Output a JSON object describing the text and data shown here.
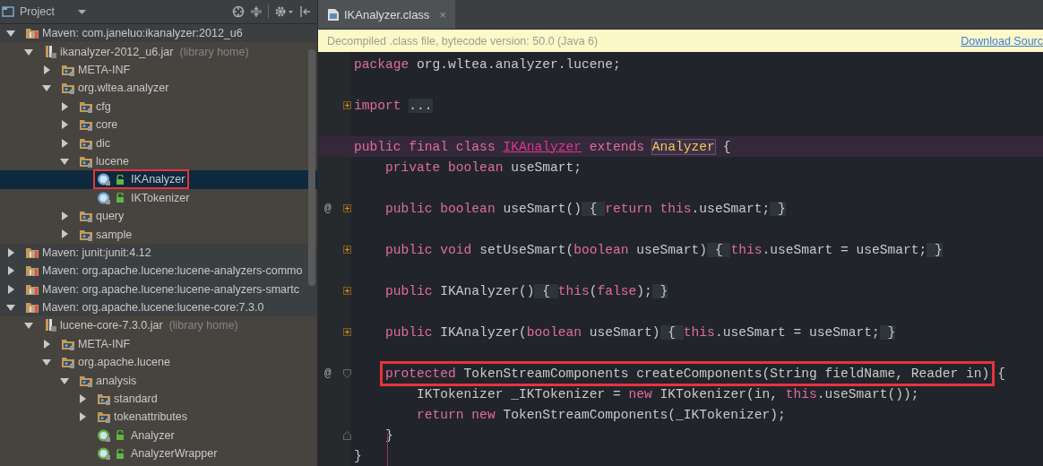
{
  "project_panel": {
    "title": "Project",
    "tree": [
      {
        "label": "Maven: com.janeluo:ikanalyzer:2012_u6",
        "kind": "maven",
        "expanded": true,
        "selected": false,
        "children": [
          {
            "label": "ikanalyzer-2012_u6.jar",
            "suffix": "(library home)",
            "kind": "jar",
            "expanded": true,
            "selected": false,
            "children": [
              {
                "label": "META-INF",
                "kind": "folder",
                "expanded": false,
                "selected": false
              },
              {
                "label": "org.wltea.analyzer",
                "kind": "folder",
                "expanded": true,
                "selected": false,
                "children": [
                  {
                    "label": "cfg",
                    "kind": "folder",
                    "expanded": false,
                    "selected": false
                  },
                  {
                    "label": "core",
                    "kind": "folder",
                    "expanded": false,
                    "selected": false
                  },
                  {
                    "label": "dic",
                    "kind": "folder",
                    "expanded": false,
                    "selected": false
                  },
                  {
                    "label": "lucene",
                    "kind": "folder",
                    "expanded": true,
                    "selected": false,
                    "children": [
                      {
                        "label": "IKAnalyzer",
                        "kind": "class",
                        "selected": true,
                        "annotated": true
                      },
                      {
                        "label": "IKTokenizer",
                        "kind": "class",
                        "selected": false
                      }
                    ]
                  },
                  {
                    "label": "query",
                    "kind": "folder",
                    "expanded": false,
                    "selected": false
                  },
                  {
                    "label": "sample",
                    "kind": "folder",
                    "expanded": false,
                    "selected": false
                  }
                ]
              }
            ]
          }
        ]
      },
      {
        "label": "Maven: junit:junit:4.12",
        "kind": "maven",
        "expanded": false,
        "selected": false
      },
      {
        "label": "Maven: org.apache.lucene:lucene-analyzers-commo",
        "kind": "maven",
        "expanded": false,
        "selected": false
      },
      {
        "label": "Maven: org.apache.lucene:lucene-analyzers-smartc",
        "kind": "maven",
        "expanded": false,
        "selected": false
      },
      {
        "label": "Maven: org.apache.lucene:lucene-core:7.3.0",
        "kind": "maven",
        "expanded": true,
        "selected": false,
        "children": [
          {
            "label": "lucene-core-7.3.0.jar",
            "suffix": "(library home)",
            "kind": "jar",
            "expanded": true,
            "selected": false,
            "children": [
              {
                "label": "META-INF",
                "kind": "folder",
                "expanded": false,
                "selected": false
              },
              {
                "label": "org.apache.lucene",
                "kind": "folder",
                "expanded": true,
                "selected": false,
                "children": [
                  {
                    "label": "analysis",
                    "kind": "folder",
                    "expanded": true,
                    "selected": false,
                    "children": [
                      {
                        "label": "standard",
                        "kind": "folder",
                        "expanded": false,
                        "selected": false
                      },
                      {
                        "label": "tokenattributes",
                        "kind": "folder",
                        "expanded": false,
                        "selected": false
                      },
                      {
                        "label": "Analyzer",
                        "kind": "abstract-class",
                        "selected": false
                      },
                      {
                        "label": "AnalyzerWrapper",
                        "kind": "abstract-class",
                        "selected": false
                      }
                    ]
                  }
                ]
              }
            ]
          }
        ]
      }
    ]
  },
  "editor": {
    "tab": {
      "label": "IKAnalyzer.class",
      "close": "×"
    },
    "banner": {
      "text": "Decompiled .class file, bytecode version: 50.0 (Java 6)",
      "link": "Download Sourc"
    },
    "code_lines": [
      {
        "kind": "code",
        "current": false,
        "tokens": [
          {
            "text": "package ",
            "kind": "keyword"
          },
          {
            "text": "org.wltea.analyzer.lucene;",
            "kind": "plain"
          }
        ]
      },
      {
        "kind": "blank"
      },
      {
        "kind": "fold-closed",
        "current": false,
        "tokens": [
          {
            "text": "import ",
            "kind": "keyword"
          },
          {
            "text": "...",
            "kind": "folded"
          }
        ]
      },
      {
        "kind": "blank"
      },
      {
        "kind": "code",
        "current": true,
        "tokens": [
          {
            "text": "public final class ",
            "kind": "keyword"
          },
          {
            "text": "IKAnalyzer",
            "kind": "declaration"
          },
          {
            "text": " extends ",
            "kind": "keyword"
          },
          {
            "text": "Analyzer",
            "kind": "reference"
          },
          {
            "text": " {",
            "kind": "plain"
          }
        ]
      },
      {
        "kind": "code",
        "current": false,
        "tokens": [
          {
            "text": "    private boolean",
            "kind": "keyword"
          },
          {
            "text": " useSmart;",
            "kind": "plain"
          }
        ]
      },
      {
        "kind": "blank"
      },
      {
        "kind": "fold-closed",
        "current": false,
        "marker": "@",
        "tokens": [
          {
            "text": "    public boolean",
            "kind": "keyword"
          },
          {
            "text": " useSmart()",
            "kind": "plain"
          },
          {
            "text": " { ",
            "kind": "folded"
          },
          {
            "text": "return this",
            "kind": "keyword"
          },
          {
            "text": ".useSmart;",
            "kind": "plain"
          },
          {
            "text": " }",
            "kind": "folded"
          }
        ]
      },
      {
        "kind": "blank"
      },
      {
        "kind": "fold-closed",
        "current": false,
        "tokens": [
          {
            "text": "    public void",
            "kind": "keyword"
          },
          {
            "text": " setUseSmart(",
            "kind": "plain"
          },
          {
            "text": "boolean",
            "kind": "keyword"
          },
          {
            "text": " useSmart)",
            "kind": "plain"
          },
          {
            "text": " { ",
            "kind": "folded"
          },
          {
            "text": "this",
            "kind": "keyword"
          },
          {
            "text": ".useSmart = useSmart;",
            "kind": "plain"
          },
          {
            "text": " }",
            "kind": "folded"
          }
        ]
      },
      {
        "kind": "blank"
      },
      {
        "kind": "fold-closed",
        "current": false,
        "tokens": [
          {
            "text": "    public",
            "kind": "keyword"
          },
          {
            "text": " IKAnalyzer()",
            "kind": "plain"
          },
          {
            "text": " { ",
            "kind": "folded"
          },
          {
            "text": "this",
            "kind": "keyword"
          },
          {
            "text": "(",
            "kind": "plain"
          },
          {
            "text": "false",
            "kind": "keyword"
          },
          {
            "text": ");",
            "kind": "plain"
          },
          {
            "text": " }",
            "kind": "folded"
          }
        ]
      },
      {
        "kind": "blank"
      },
      {
        "kind": "fold-closed",
        "current": false,
        "tokens": [
          {
            "text": "    public",
            "kind": "keyword"
          },
          {
            "text": " IKAnalyzer(",
            "kind": "plain"
          },
          {
            "text": "boolean",
            "kind": "keyword"
          },
          {
            "text": " useSmart)",
            "kind": "plain"
          },
          {
            "text": " { ",
            "kind": "folded"
          },
          {
            "text": "this",
            "kind": "keyword"
          },
          {
            "text": ".useSmart = useSmart;",
            "kind": "plain"
          },
          {
            "text": " }",
            "kind": "folded"
          }
        ]
      },
      {
        "kind": "blank"
      },
      {
        "kind": "fold-start",
        "current": false,
        "annotated": true,
        "marker": "@",
        "tokens": [
          {
            "text": "protected",
            "kind": "keyword"
          },
          {
            "text": " TokenStreamComponents createComponents(String fieldName, Reader in)",
            "kind": "plain"
          }
        ],
        "trailing": [
          {
            "text": " {",
            "kind": "plain"
          }
        ]
      },
      {
        "kind": "code",
        "current": false,
        "tokens": [
          {
            "text": "        IKTokenizer _IKTokenizer = ",
            "kind": "plain"
          },
          {
            "text": "new",
            "kind": "keyword"
          },
          {
            "text": " IKTokenizer(in, ",
            "kind": "plain"
          },
          {
            "text": "this",
            "kind": "keyword"
          },
          {
            "text": ".useSmart());",
            "kind": "plain"
          }
        ]
      },
      {
        "kind": "code",
        "current": false,
        "tokens": [
          {
            "text": "        return new",
            "kind": "keyword"
          },
          {
            "text": " TokenStreamComponents(_IKTokenizer);",
            "kind": "plain"
          }
        ]
      },
      {
        "kind": "fold-end",
        "current": false,
        "tokens": [
          {
            "text": "    }",
            "kind": "plain"
          }
        ]
      },
      {
        "kind": "code",
        "current": false,
        "tokens": [
          {
            "text": "}",
            "kind": "plain"
          }
        ]
      }
    ]
  }
}
